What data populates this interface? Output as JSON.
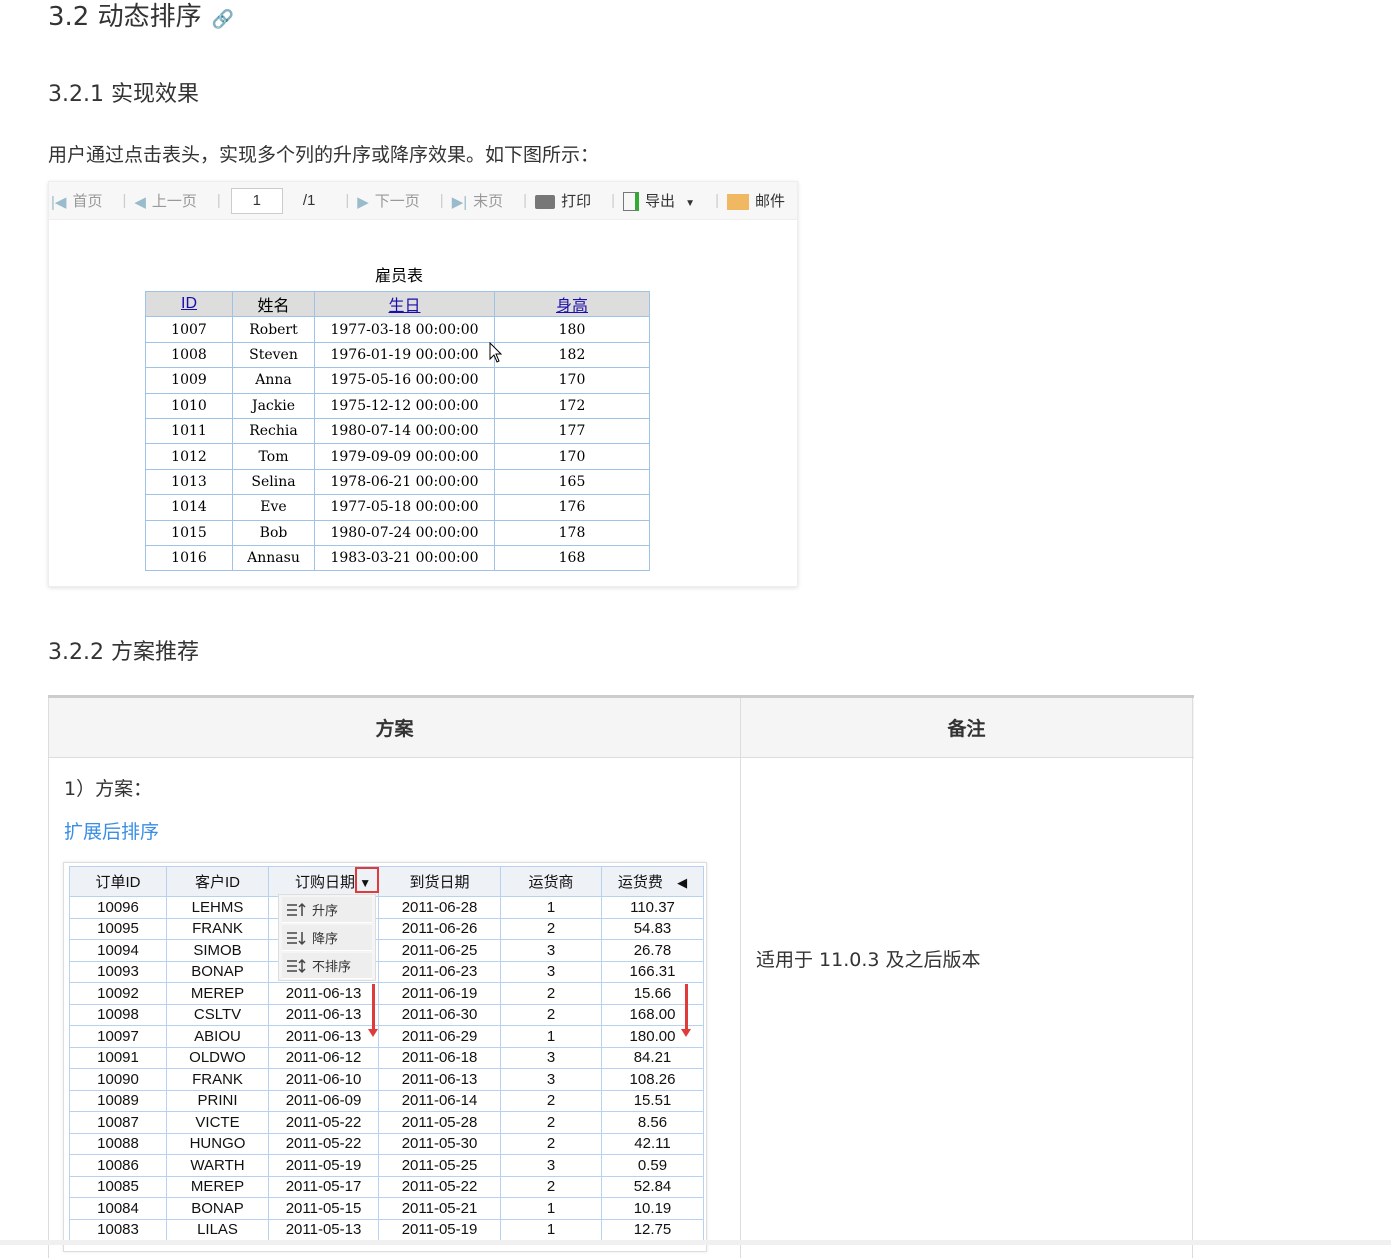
{
  "heading": "3.2 动态排序",
  "sub1": "3.2.1 实现效果",
  "intro": "用户通过点击表头，实现多个列的升序或降序效果。如下图所示：",
  "toolbar": {
    "first": "首页",
    "prev": "上一页",
    "page": "1",
    "total": "/1",
    "next": "下一页",
    "last": "末页",
    "print": "打印",
    "export": "导出",
    "mail": "邮件"
  },
  "employee": {
    "title": "雇员表",
    "headers": [
      "ID",
      "姓名",
      "生日",
      "身高"
    ],
    "rows": [
      [
        "1007",
        "Robert",
        "1977-03-18 00:00:00",
        "180"
      ],
      [
        "1008",
        "Steven",
        "1976-01-19 00:00:00",
        "182"
      ],
      [
        "1009",
        "Anna",
        "1975-05-16 00:00:00",
        "170"
      ],
      [
        "1010",
        "Jackie",
        "1975-12-12 00:00:00",
        "172"
      ],
      [
        "1011",
        "Rechia",
        "1980-07-14 00:00:00",
        "177"
      ],
      [
        "1012",
        "Tom",
        "1979-09-09 00:00:00",
        "170"
      ],
      [
        "1013",
        "Selina",
        "1978-06-21 00:00:00",
        "165"
      ],
      [
        "1014",
        "Eve",
        "1977-05-18 00:00:00",
        "176"
      ],
      [
        "1015",
        "Bob",
        "1980-07-24 00:00:00",
        "178"
      ],
      [
        "1016",
        "Annasu",
        "1983-03-21 00:00:00",
        "168"
      ]
    ]
  },
  "sub2": "3.2.2 方案推荐",
  "table": {
    "col1": "方案",
    "col2": "备注",
    "plan_label": "1）方案：",
    "plan_link": "扩展后排序",
    "note": "适用于 11.0.3 及之后版本"
  },
  "orders": {
    "headers": [
      "订单ID",
      "客户ID",
      "订购日期",
      "到货日期",
      "运货商",
      "运货费"
    ],
    "menu": [
      "升序",
      "降序",
      "不排序"
    ],
    "rows": [
      [
        "10096",
        "LEHMS",
        "",
        "2011-06-28",
        "1",
        "110.37"
      ],
      [
        "10095",
        "FRANK",
        "",
        "2011-06-26",
        "2",
        "54.83"
      ],
      [
        "10094",
        "SIMOB",
        "",
        "2011-06-25",
        "3",
        "26.78"
      ],
      [
        "10093",
        "BONAP",
        "",
        "2011-06-23",
        "3",
        "166.31"
      ],
      [
        "10092",
        "MEREP",
        "2011-06-13",
        "2011-06-19",
        "2",
        "15.66"
      ],
      [
        "10098",
        "CSLTV",
        "2011-06-13",
        "2011-06-30",
        "2",
        "168.00"
      ],
      [
        "10097",
        "ABIOU",
        "2011-06-13",
        "2011-06-29",
        "1",
        "180.00"
      ],
      [
        "10091",
        "OLDWO",
        "2011-06-12",
        "2011-06-18",
        "3",
        "84.21"
      ],
      [
        "10090",
        "FRANK",
        "2011-06-10",
        "2011-06-13",
        "3",
        "108.26"
      ],
      [
        "10089",
        "PRINI",
        "2011-06-09",
        "2011-06-14",
        "2",
        "15.51"
      ],
      [
        "10087",
        "VICTE",
        "2011-05-22",
        "2011-05-28",
        "2",
        "8.56"
      ],
      [
        "10088",
        "HUNGO",
        "2011-05-22",
        "2011-05-30",
        "2",
        "42.11"
      ],
      [
        "10086",
        "WARTH",
        "2011-05-19",
        "2011-05-25",
        "3",
        "0.59"
      ],
      [
        "10085",
        "MEREP",
        "2011-05-17",
        "2011-05-22",
        "2",
        "52.84"
      ],
      [
        "10084",
        "BONAP",
        "2011-05-15",
        "2011-05-21",
        "1",
        "10.19"
      ],
      [
        "10083",
        "LILAS",
        "2011-05-13",
        "2011-05-19",
        "1",
        "12.75"
      ]
    ]
  }
}
